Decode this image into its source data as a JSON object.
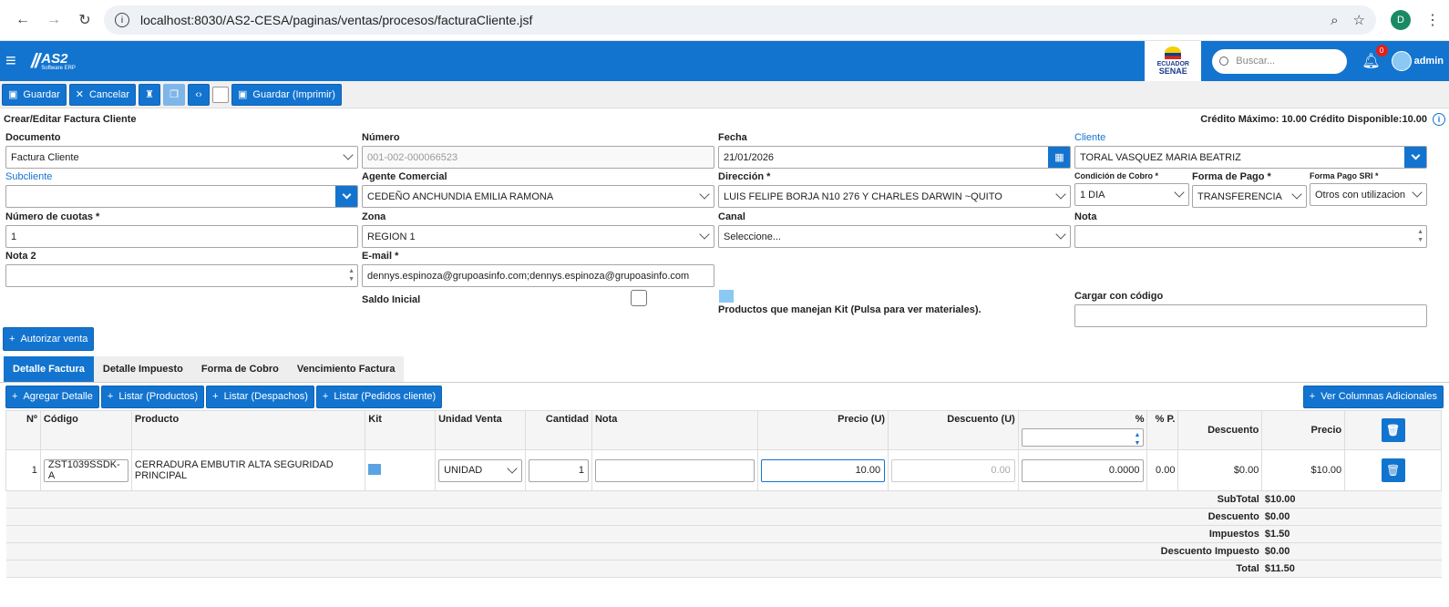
{
  "browser": {
    "url": "localhost:8030/AS2-CESA/paginas/ventas/procesos/facturaCliente.jsf",
    "profile_initial": "D"
  },
  "app": {
    "logo_text": "AS2",
    "logo_sub": "Software ERP",
    "partner_logo": "ADUANA DEL ECUADOR SENAE",
    "search_placeholder": "Buscar...",
    "notifications": "0",
    "user": "admin"
  },
  "toolbar": {
    "guardar": "Guardar",
    "cancelar": "Cancelar",
    "guardar_imprimir": "Guardar (Imprimir)"
  },
  "page": {
    "title": "Crear/Editar Factura Cliente",
    "credit": "Crédito Máximo: 10.00 Crédito Disponible:10.00"
  },
  "form": {
    "documento": {
      "label": "Documento",
      "value": "Factura Cliente"
    },
    "numero": {
      "label": "Número",
      "value": "001-002-000066523"
    },
    "fecha": {
      "label": "Fecha",
      "value": "21/01/2026"
    },
    "cliente": {
      "label": "Cliente",
      "value": "TORAL VASQUEZ MARIA BEATRIZ"
    },
    "subcliente": {
      "label": "Subcliente",
      "value": ""
    },
    "agente": {
      "label": "Agente Comercial",
      "value": "CEDEÑO ANCHUNDIA EMILIA RAMONA"
    },
    "direccion": {
      "label": "Dirección *",
      "value": "LUIS FELIPE BORJA N10 276 Y CHARLES DARWIN ~QUITO"
    },
    "condicion": {
      "label": "Condición de Cobro *",
      "value": "1 DIA"
    },
    "forma_pago": {
      "label": "Forma de Pago *",
      "value": "TRANSFERENCIA"
    },
    "forma_sri": {
      "label": "Forma Pago SRI *",
      "value": "Otros con utilizacion"
    },
    "cuotas": {
      "label": "Número de cuotas *",
      "value": "1"
    },
    "zona": {
      "label": "Zona",
      "value": "REGION 1"
    },
    "canal": {
      "label": "Canal",
      "value": "Seleccione..."
    },
    "nota": {
      "label": "Nota",
      "value": ""
    },
    "nota2": {
      "label": "Nota 2",
      "value": ""
    },
    "email": {
      "label": "E-mail *",
      "value": "dennys.espinoza@grupoasinfo.com;dennys.espinoza@grupoasinfo.com"
    },
    "saldo_inicial": {
      "label": "Saldo Inicial"
    },
    "kit": {
      "label": "Productos que manejan Kit (Pulsa para ver materiales)."
    },
    "cargar": {
      "label": "Cargar con código",
      "value": ""
    },
    "autorizar": "Autorizar venta"
  },
  "tabs": [
    "Detalle Factura",
    "Detalle Impuesto",
    "Forma de Cobro",
    "Vencimiento Factura"
  ],
  "actions": {
    "agregar": "Agregar Detalle",
    "productos": "Listar (Productos)",
    "despachos": "Listar (Despachos)",
    "pedidos": "Listar (Pedidos cliente)",
    "columnas": "Ver Columnas Adicionales"
  },
  "table": {
    "headers": [
      "Nº",
      "Código",
      "Producto",
      "Kit",
      "Unidad Venta",
      "Cantidad",
      "Nota",
      "Precio (U)",
      "Descuento (U)",
      "%",
      "% P.",
      "Descuento",
      "Precio"
    ],
    "row": {
      "n": "1",
      "codigo": "ZST1039SSDK-A",
      "producto": "CERRADURA EMBUTIR ALTA SEGURIDAD PRINCIPAL",
      "unidad": "UNIDAD",
      "cantidad": "1",
      "nota": "",
      "precio_u": "10.00",
      "descuento_u": "0.00",
      "pct": "0.0000",
      "pct_p": "0.00",
      "descuento": "$0.00",
      "precio": "$10.00"
    },
    "totals": [
      {
        "label": "SubTotal",
        "value": "$10.00"
      },
      {
        "label": "Descuento",
        "value": "$0.00"
      },
      {
        "label": "Impuestos",
        "value": "$1.50"
      },
      {
        "label": "Descuento Impuesto",
        "value": "$0.00"
      },
      {
        "label": "Total",
        "value": "$11.50"
      }
    ]
  }
}
